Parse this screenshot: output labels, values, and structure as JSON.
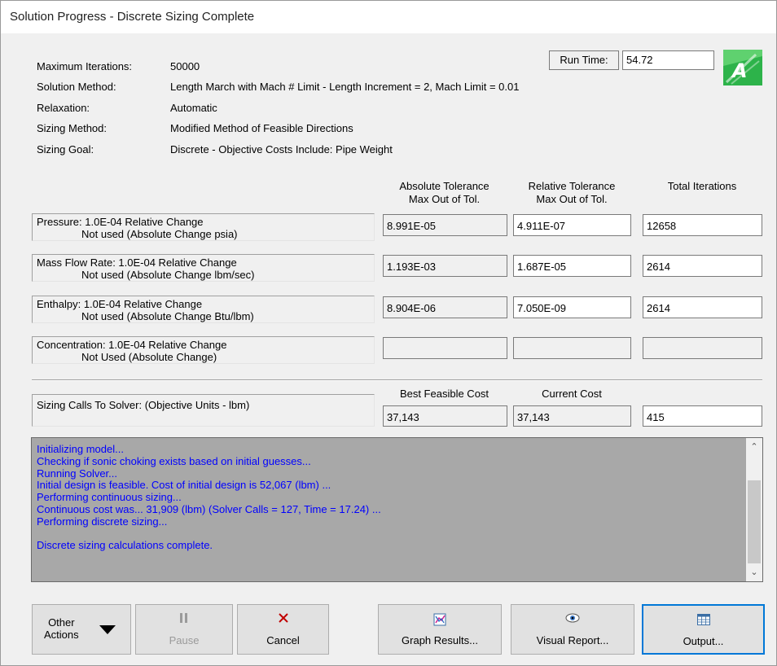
{
  "window": {
    "title": "Solution Progress - Discrete Sizing Complete"
  },
  "info": {
    "rows": [
      {
        "label": "Maximum Iterations:",
        "value": "50000"
      },
      {
        "label": "Solution Method:",
        "value": "Length March with Mach # Limit - Length Increment = 2, Mach Limit = 0.01"
      },
      {
        "label": "Relaxation:",
        "value": "Automatic"
      },
      {
        "label": "Sizing Method:",
        "value": "Modified Method of Feasible Directions"
      },
      {
        "label": "Sizing Goal:",
        "value": "Discrete - Objective Costs Include: Pipe Weight"
      }
    ],
    "run_time_label": "Run Time:",
    "run_time_value": "54.72"
  },
  "tolerance": {
    "headers": {
      "abs_line1": "Absolute Tolerance",
      "abs_line2": "Max Out of Tol.",
      "rel_line1": "Relative Tolerance",
      "rel_line2": "Max Out of Tol.",
      "total": "Total Iterations"
    },
    "rows": [
      {
        "line1": "Pressure: 1.0E-04 Relative Change",
        "line2": "Not used (Absolute Change psia)",
        "abs": "8.991E-05",
        "rel": "4.911E-07",
        "iter": "12658"
      },
      {
        "line1": "Mass Flow Rate: 1.0E-04 Relative Change",
        "line2": "Not used (Absolute Change lbm/sec)",
        "abs": "1.193E-03",
        "rel": "1.687E-05",
        "iter": "2614"
      },
      {
        "line1": "Enthalpy: 1.0E-04 Relative Change",
        "line2": "Not used (Absolute Change Btu/lbm)",
        "abs": "8.904E-06",
        "rel": "7.050E-09",
        "iter": "2614"
      },
      {
        "line1": "Concentration: 1.0E-04 Relative Change",
        "line2": "Not Used (Absolute Change)",
        "abs": "",
        "rel": "",
        "iter": ""
      }
    ]
  },
  "sizing": {
    "label": "Sizing Calls To Solver: (Objective Units - lbm)",
    "best_header": "Best Feasible Cost",
    "current_header": "Current Cost",
    "best_value": "37,143",
    "current_value": "37,143",
    "calls_value": "415"
  },
  "log": {
    "lines": [
      "Initializing model...",
      "Checking if sonic choking exists based on initial guesses...",
      "Running Solver...",
      "Initial design is feasible. Cost of initial design is 52,067 (lbm) ...",
      "Performing continuous sizing...",
      "Continuous cost was... 31,909 (lbm)  (Solver Calls = 127, Time = 17.24) ...",
      "Performing discrete sizing...",
      "",
      "Discrete sizing calculations complete."
    ],
    "text_color": "#0000ff",
    "background": "#a8a8a8"
  },
  "buttons": {
    "other_actions_line1": "Other",
    "other_actions_line2": "Actions",
    "pause": "Pause",
    "cancel": "Cancel",
    "graph_results": "Graph Results...",
    "visual_report": "Visual Report...",
    "output": "Output..."
  },
  "icons": {
    "logo": "aft-arrow-logo-icon",
    "pause": "pause-icon",
    "cancel": "x-icon",
    "graph": "graph-icon",
    "visual": "eye-icon",
    "output": "table-icon",
    "dropdown": "triangle-down-icon"
  },
  "colors": {
    "accent": "#0078d7",
    "logo_green": "#2db34a"
  }
}
